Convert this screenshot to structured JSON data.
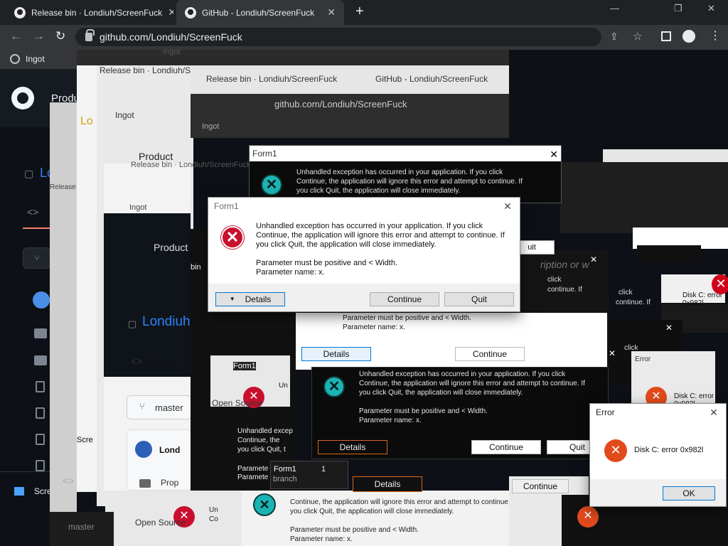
{
  "browser": {
    "tabs": [
      {
        "title": "Release bin · Londiuh/ScreenFuck"
      },
      {
        "title": "GitHub - Londiuh/ScreenFuck"
      }
    ],
    "url": "github.com/Londiuh/ScreenFuck",
    "bookmark": "Ingot"
  },
  "github": {
    "product": "Product",
    "repo_initial": "Lo",
    "repo_name": "Londiuh",
    "code_tab": "Code",
    "branch": "master",
    "open_source": "Open Source",
    "release": "Release",
    "owner": "Lond",
    "folder": "Prop",
    "screen": "Scre",
    "search_hint": "ription or w",
    "branch_small": "branch"
  },
  "dialog_main": {
    "title": "Form1",
    "message_1": "Unhandled exception has occurred in your application. If you click",
    "message_2": "Continue, the application will ignore this error and attempt to continue. If",
    "message_3": "you click Quit, the application will close immediately.",
    "param_1": "Parameter must be positive and < Width.",
    "param_2": "Parameter name: x.",
    "details": "Details",
    "continue": "Continue",
    "quit": "Quit"
  },
  "dialog_error": {
    "title": "Error",
    "message": "Disk C: error 0x982l",
    "ok": "OK"
  },
  "ghost": {
    "title": "Form1",
    "title_small": "Form1",
    "disk_partial": "Disk C: error 0x982l",
    "quit_short": "uit",
    "click": "click",
    "continue_if": "continue. If",
    "unhandled_short": "Unhandled excep",
    "continue_short": "Continue, the",
    "quit_short2": "you click Quit, t",
    "parameter_short": "Paramete",
    "bin": "bin",
    "count": "1",
    "un": "Un",
    "co": "Co"
  },
  "colors": {
    "error_red": "#c8102e",
    "accent_blue": "#0078d7",
    "gh_bg": "#0d1117",
    "chrome_bg": "#202124"
  }
}
